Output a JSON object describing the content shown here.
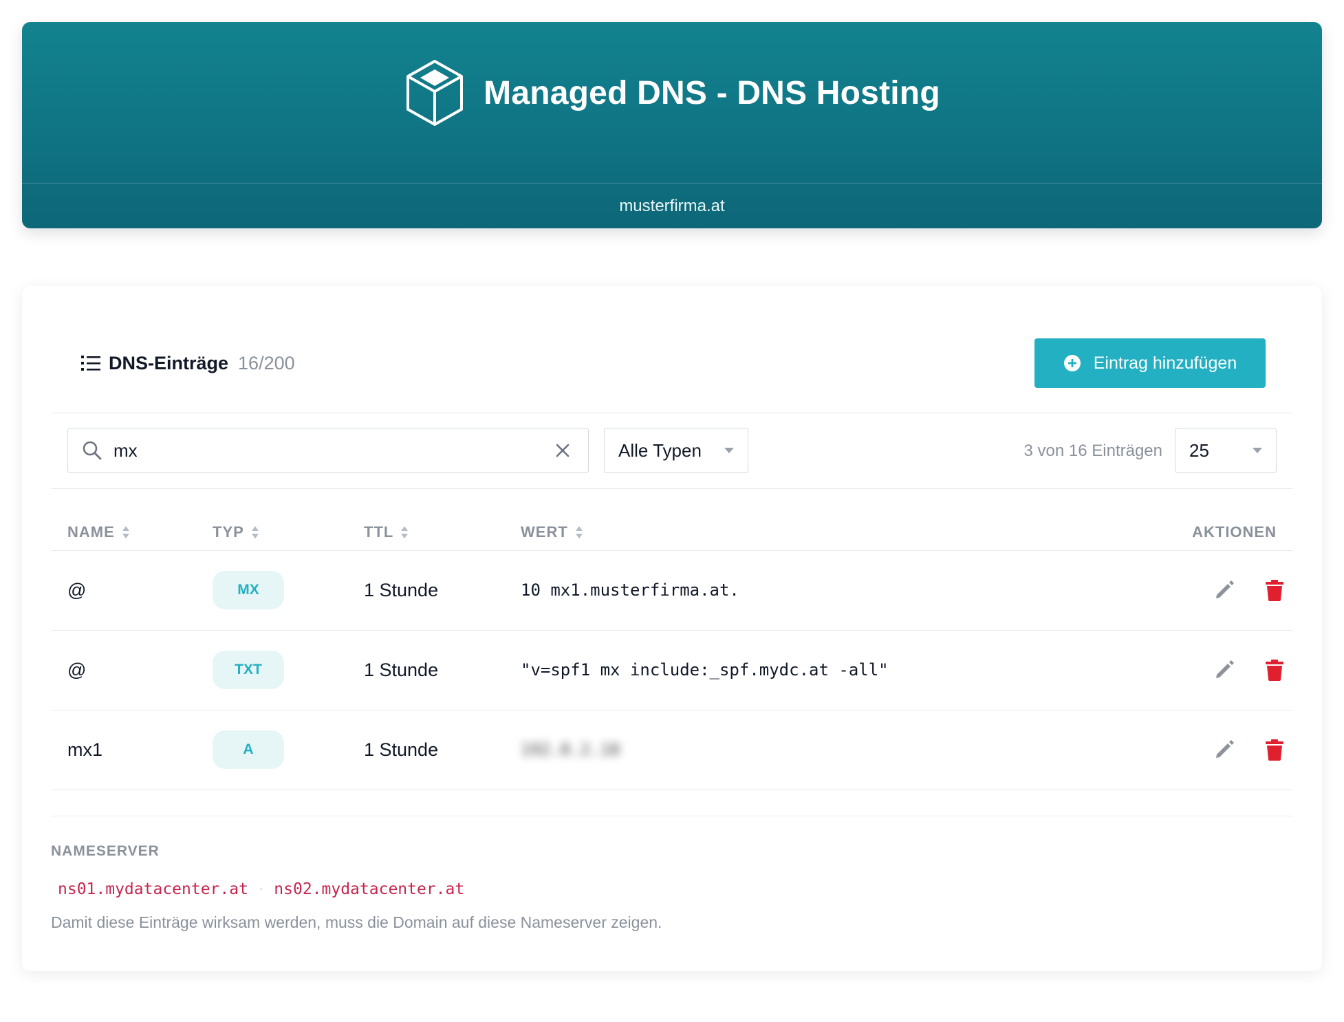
{
  "header": {
    "title": "Managed DNS - DNS Hosting",
    "domain": "musterfirma.at",
    "logo_icon": "cube-icon"
  },
  "records_panel": {
    "title": "DNS-Einträge",
    "count": "16/200",
    "add_button_label": "Eintrag hinzufügen",
    "add_button_color": "#22b0c2"
  },
  "filters": {
    "search_value": "mx",
    "type_filter": "Alle Typen",
    "result_count": "3 von 16 Einträgen",
    "page_size": "25"
  },
  "table": {
    "columns": [
      "NAME",
      "TYP",
      "TTL",
      "WERT",
      "AKTIONEN"
    ],
    "rows": [
      {
        "name": "@",
        "type": "MX",
        "ttl": "1 Stunde",
        "value": "10 mx1.musterfirma.at."
      },
      {
        "name": "@",
        "type": "TXT",
        "ttl": "1 Stunde",
        "value": "\"v=spf1 mx include:_spf.mydc.at -all\""
      },
      {
        "name": "mx1",
        "type": "A",
        "ttl": "1 Stunde",
        "value": "192.0.2.10"
      }
    ]
  },
  "nameserver": {
    "label": "NAMESERVER",
    "servers": [
      "ns01.mydatacenter.at",
      "ns02.mydatacenter.at"
    ],
    "note": "Damit diese Einträge wirksam werden, muss die Domain auf diese Nameserver zeigen."
  },
  "colors": {
    "header": "#107b8a",
    "accent": "#22b0c2",
    "delete": "#e0202e",
    "edit": "#8d939b",
    "nameserver_text": "#c7254e"
  }
}
